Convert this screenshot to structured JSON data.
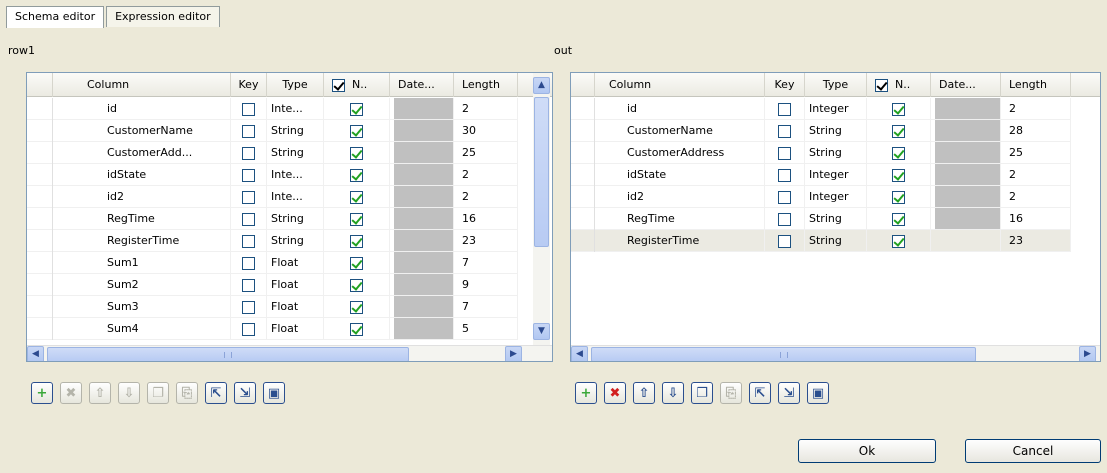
{
  "tabs": [
    {
      "label": "Schema editor",
      "active": true
    },
    {
      "label": "Expression editor",
      "active": false
    }
  ],
  "left": {
    "title": "row1",
    "headers": {
      "column": "Column",
      "key": "Key",
      "type": "Type",
      "nullable": "N..",
      "date": "Date...",
      "length": "Length"
    },
    "rows": [
      {
        "column": "id",
        "key": false,
        "type": "Inte...",
        "nullable": true,
        "length": "2"
      },
      {
        "column": "CustomerName",
        "key": false,
        "type": "String",
        "nullable": true,
        "length": "30"
      },
      {
        "column": "CustomerAdd...",
        "key": false,
        "type": "String",
        "nullable": true,
        "length": "25"
      },
      {
        "column": "idState",
        "key": false,
        "type": "Inte...",
        "nullable": true,
        "length": "2"
      },
      {
        "column": "id2",
        "key": false,
        "type": "Inte...",
        "nullable": true,
        "length": "2"
      },
      {
        "column": "RegTime",
        "key": false,
        "type": "String",
        "nullable": true,
        "length": "16"
      },
      {
        "column": "RegisterTime",
        "key": false,
        "type": "String",
        "nullable": true,
        "length": "23"
      },
      {
        "column": "Sum1",
        "key": false,
        "type": "Float",
        "nullable": true,
        "length": "7"
      },
      {
        "column": "Sum2",
        "key": false,
        "type": "Float",
        "nullable": true,
        "length": "9"
      },
      {
        "column": "Sum3",
        "key": false,
        "type": "Float",
        "nullable": true,
        "length": "7"
      },
      {
        "column": "Sum4",
        "key": false,
        "type": "Float",
        "nullable": true,
        "length": "5"
      }
    ]
  },
  "right": {
    "title": "out",
    "headers": {
      "column": "Column",
      "key": "Key",
      "type": "Type",
      "nullable": "N..",
      "date": "Date...",
      "length": "Length"
    },
    "rows": [
      {
        "column": "id",
        "key": false,
        "type": "Integer",
        "nullable": true,
        "length": "2"
      },
      {
        "column": "CustomerName",
        "key": false,
        "type": "String",
        "nullable": true,
        "length": "28"
      },
      {
        "column": "CustomerAddress",
        "key": false,
        "type": "String",
        "nullable": true,
        "length": "25"
      },
      {
        "column": "idState",
        "key": false,
        "type": "Integer",
        "nullable": true,
        "length": "2"
      },
      {
        "column": "id2",
        "key": false,
        "type": "Integer",
        "nullable": true,
        "length": "2"
      },
      {
        "column": "RegTime",
        "key": false,
        "type": "String",
        "nullable": true,
        "length": "16"
      },
      {
        "column": "RegisterTime",
        "key": false,
        "type": "String",
        "nullable": true,
        "length": "23"
      }
    ]
  },
  "toolbar_icons": {
    "add": "+",
    "remove": "✖",
    "up": "⇧",
    "down": "⇩",
    "copy": "❐",
    "paste": "⎘",
    "import": "⇱",
    "export": "⇲",
    "save": "▣"
  },
  "buttons": {
    "ok": "Ok",
    "cancel": "Cancel"
  },
  "colors": {
    "check": "#21a121",
    "remove_active": "#d22020",
    "add": "#3aa83a",
    "selection": "#ebeae2"
  }
}
